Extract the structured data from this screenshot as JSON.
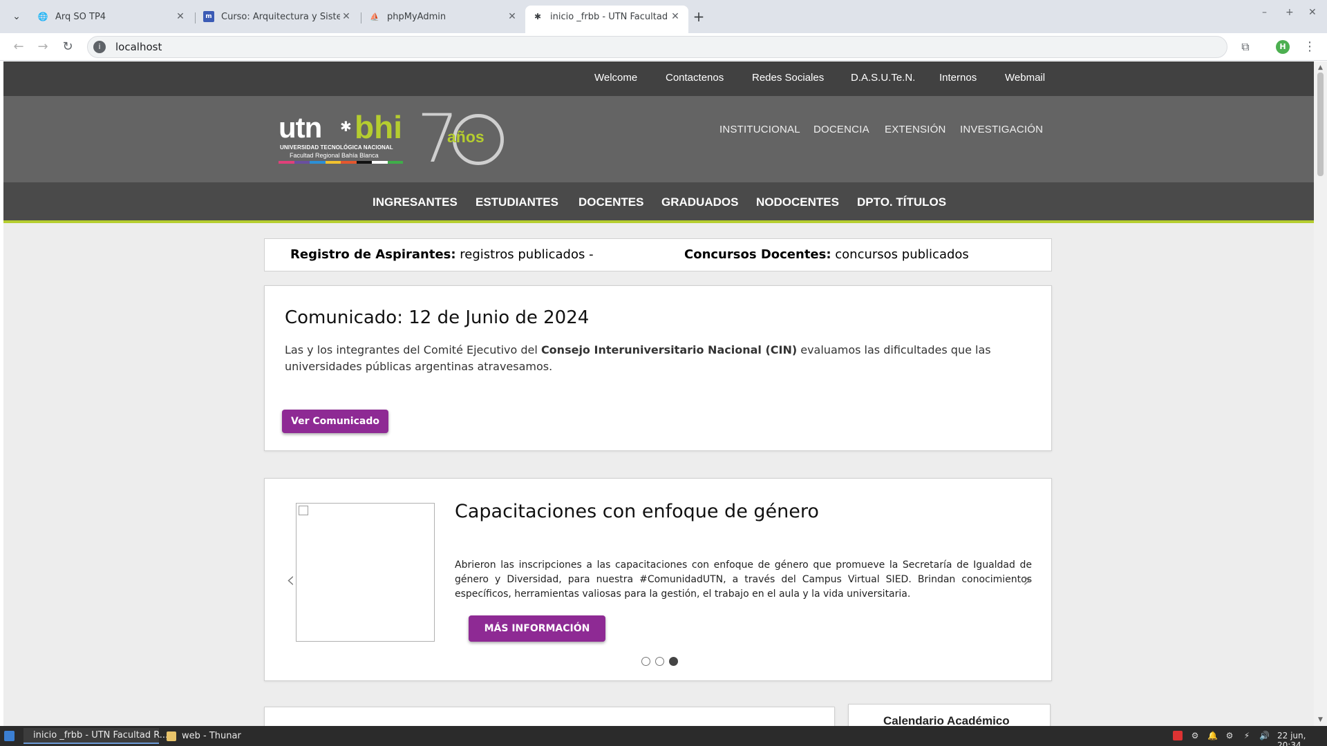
{
  "browser": {
    "tabs": [
      {
        "title": "Arq SO TP4"
      },
      {
        "title": "Curso: Arquitectura y Sistemas"
      },
      {
        "title": "phpMyAdmin"
      },
      {
        "title": "inicio _frbb - UTN Facultad Re"
      }
    ],
    "url": "localhost",
    "profile_initial": "H"
  },
  "site": {
    "topnav": [
      "Welcome",
      "Contactenos",
      "Redes Sociales",
      "D.A.S.U.Te.N.",
      "Internos",
      "Webmail"
    ],
    "logo": {
      "utn": "utn",
      "bhi": "bhi",
      "university": "UNIVERSIDAD TECNOLÓGICA NACIONAL",
      "faculty": "Facultad Regional Bahía Blanca",
      "anniversary_num": "70",
      "anniversary_word": "años",
      "stripe_colors": [
        "#e0407a",
        "#6a4fa0",
        "#2b8fd6",
        "#f2c12e",
        "#e4572e",
        "#111111",
        "#ffffff",
        "#3fae49"
      ]
    },
    "secondary_nav": [
      "INSTITUCIONAL",
      "DOCENCIA",
      "EXTENSIÓN",
      "INVESTIGACIÓN"
    ],
    "main_nav": [
      "INGRESANTES",
      "ESTUDIANTES",
      "DOCENTES",
      "GRADUADOS",
      "NODOCENTES",
      "DPTO. TÍTULOS"
    ],
    "ticker": {
      "item1_label": "Registro de Aspirantes:",
      "item1_text": " registros publicados -",
      "item2_label": "Concursos Docentes:",
      "item2_text": " concursos publicados"
    },
    "comunicado": {
      "title": "Comunicado: 12 de Junio de 2024",
      "text_before": "Las y los integrantes del Comité Ejecutivo del ",
      "text_bold": "Consejo Interuniversitario Nacional (CIN)",
      "text_after": " evaluamos las dificultades que las universidades públicas argentinas atravesamos.",
      "button": "Ver Comunicado"
    },
    "slider": {
      "title": "Capacitaciones con enfoque de género",
      "text": "Abrieron las inscripciones a las capacitaciones con enfoque de género que promueve la Secretaría de Igualdad de género y Diversidad, para nuestra #ComunidadUTN, a través del Campus Virtual SIED. Brindan conocimientos específicos, herramientas valiosas para la gestión, el trabajo en el aula y la vida universitaria.",
      "button": "MÁS INFORMACIÓN",
      "active_slide": 3,
      "slide_count": 3
    },
    "bottom_right_card_title": "Calendario Académico",
    "colors": {
      "accent_green": "#b5cd2f",
      "button_purple": "#8e2a94",
      "topnav_bg": "#414141",
      "header_bg": "#646464"
    }
  },
  "taskbar": {
    "tasks": [
      "inicio _frbb - UTN Facultad R...",
      "web - Thunar"
    ],
    "clock": "22 jun, 20:34"
  }
}
